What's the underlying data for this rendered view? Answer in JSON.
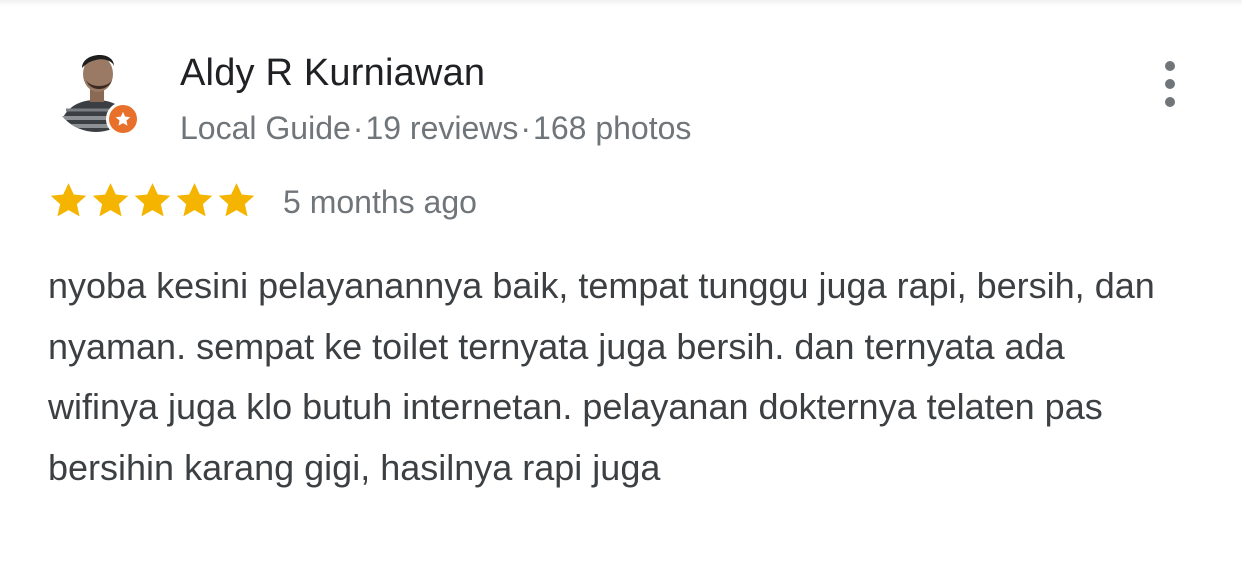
{
  "review": {
    "reviewer": {
      "name": "Aldy R Kurniawan",
      "badge": "Local Guide",
      "separator": "·",
      "reviews": "19 reviews",
      "photos": "168 photos",
      "avatar_icon": "user-avatar-icon",
      "badge_icon": "local-guide-star-icon"
    },
    "rating": {
      "stars": 5,
      "max": 5,
      "star_color": "#f4b400",
      "date": "5 months ago"
    },
    "text": "nyoba kesini pelayanannya baik, tempat tunggu juga rapi, bersih, dan nyaman. sempat ke toilet ternyata juga bersih. dan ternyata ada wifinya juga klo butuh internetan. pelayanan dokternya telaten pas bersihin karang gigi, hasilnya rapi juga",
    "menu_icon": "more-vert-icon",
    "colors": {
      "name": "#202124",
      "meta": "#70757a",
      "body": "#3c4043",
      "badge": "#e8702a"
    }
  }
}
